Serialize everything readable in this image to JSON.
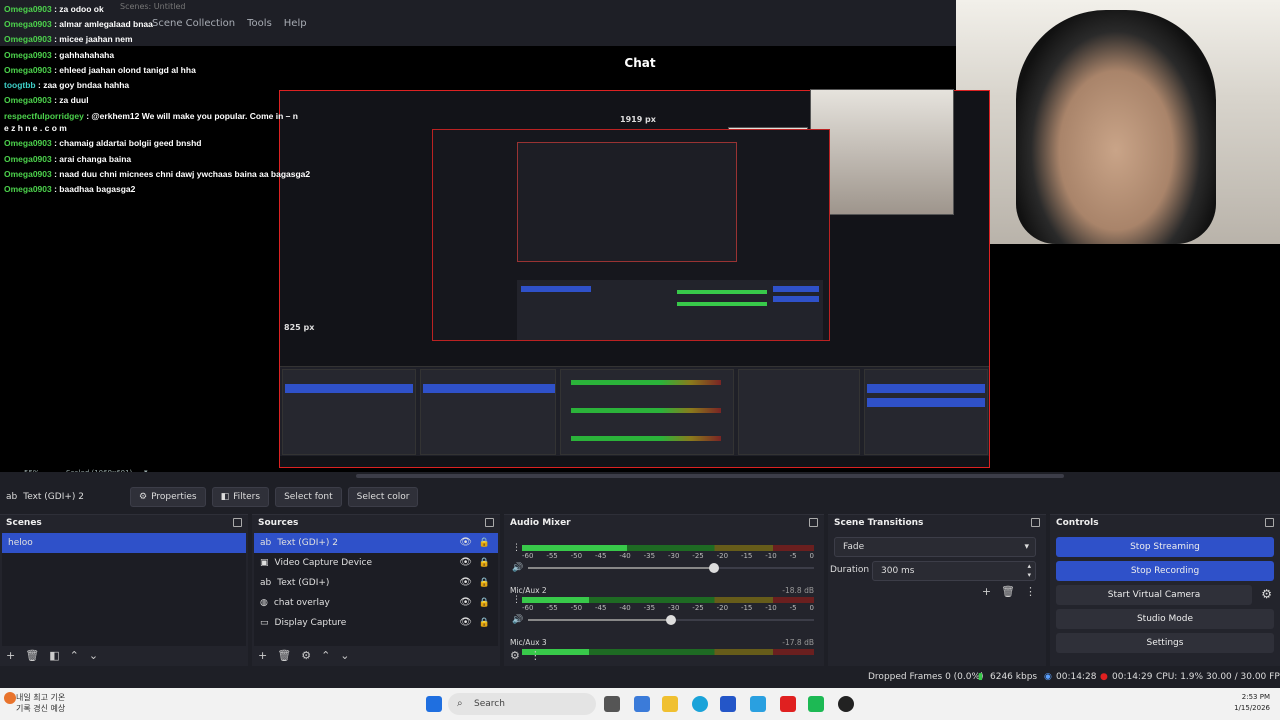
{
  "window": {
    "title": "Scenes: Untitled",
    "menus": [
      "Scene Collection",
      "Tools",
      "Help"
    ]
  },
  "preview": {
    "chat_title": "Chat",
    "chat_lines": [
      {
        "user": "Omega0903",
        "text": ": za odoo ok"
      },
      {
        "user": "Omega0903",
        "text": ": almar amlegalaad bnaa"
      },
      {
        "user": "Omega0903",
        "text": ": micee jaahan nem"
      },
      {
        "user": "Omega0903",
        "text": ": gahhahahaha"
      },
      {
        "user": "Omega0903",
        "text": ": ehleed jaahan olond tanigd al hha"
      },
      {
        "user": "toogtbb",
        "text": ": zaa goy bndaa hahha"
      },
      {
        "user": "Omega0903",
        "text": ": za duul"
      },
      {
        "user": "respectfulporridgey",
        "text": ": @erkhem12 We will make you popular. Come in – n e z h n e . c o m"
      },
      {
        "user": "Omega0903",
        "text": ": chamaig aldartai bolgii geed bnshd"
      },
      {
        "user": "Omega0903",
        "text": ": arai changa baina"
      },
      {
        "user": "Omega0903",
        "text": ": naad duu chni micnees chni dawj ywchaas baina aa bagasga2"
      },
      {
        "user": "Omega0903",
        "text": ": baadhaa bagasga2"
      }
    ],
    "nested_width_label": "1919 px",
    "nested_height_label": "825 px",
    "zoom": "55%",
    "scale": "Scaled (1069x601)"
  },
  "toolbar": {
    "source_name": "Text (GDI+) 2",
    "properties": "Properties",
    "filters": "Filters",
    "select_font": "Select font",
    "select_color": "Select color"
  },
  "scenes": {
    "title": "Scenes",
    "items": [
      "heloo"
    ]
  },
  "sources": {
    "title": "Sources",
    "items": [
      {
        "label": "Text (GDI+) 2",
        "icon": "text-icon"
      },
      {
        "label": "Video Capture Device",
        "icon": "camera-icon"
      },
      {
        "label": "Text (GDI+)",
        "icon": "text-icon"
      },
      {
        "label": "chat overlay",
        "icon": "globe-icon"
      },
      {
        "label": "Display Capture",
        "icon": "monitor-icon"
      }
    ]
  },
  "mixer": {
    "title": "Audio Mixer",
    "scale": [
      "-60",
      "-55",
      "-50",
      "-45",
      "-40",
      "-35",
      "-30",
      "-25",
      "-20",
      "-15",
      "-10",
      "-5",
      "0"
    ],
    "channels": [
      {
        "name": "",
        "db": "",
        "level": 0.36,
        "volume": 0.65
      },
      {
        "name": "Mic/Aux 2",
        "db": "-18.8 dB",
        "level": 0.23,
        "volume": 0.5
      },
      {
        "name": "Mic/Aux 3",
        "db": "-17.8 dB",
        "level": 0.23,
        "volume": 0.5
      }
    ]
  },
  "transitions": {
    "title": "Scene Transitions",
    "type": "Fade",
    "duration_label": "Duration",
    "duration_value": "300 ms"
  },
  "controls": {
    "title": "Controls",
    "stop_streaming": "Stop Streaming",
    "stop_recording": "Stop Recording",
    "virtual_camera": "Start Virtual Camera",
    "studio_mode": "Studio Mode",
    "settings": "Settings"
  },
  "status": {
    "dropped": "Dropped Frames 0 (0.0%)",
    "bitrate": "6246 kbps",
    "stream_time": "00:14:28",
    "rec_time": "00:14:29",
    "cpu": "CPU: 1.9%",
    "fps": "30.00 / 30.00 FPS"
  },
  "taskbar": {
    "weather_line1": "내일 최고 기온",
    "weather_line2": "기록 경신 예상",
    "search": "Search",
    "time": "2:53 PM",
    "date": "1/15/2026"
  },
  "colors": {
    "accent": "#2f51c9",
    "chat_user": "#4cd24c",
    "meter_green": "#38c94a",
    "rec_red": "#e02020"
  }
}
